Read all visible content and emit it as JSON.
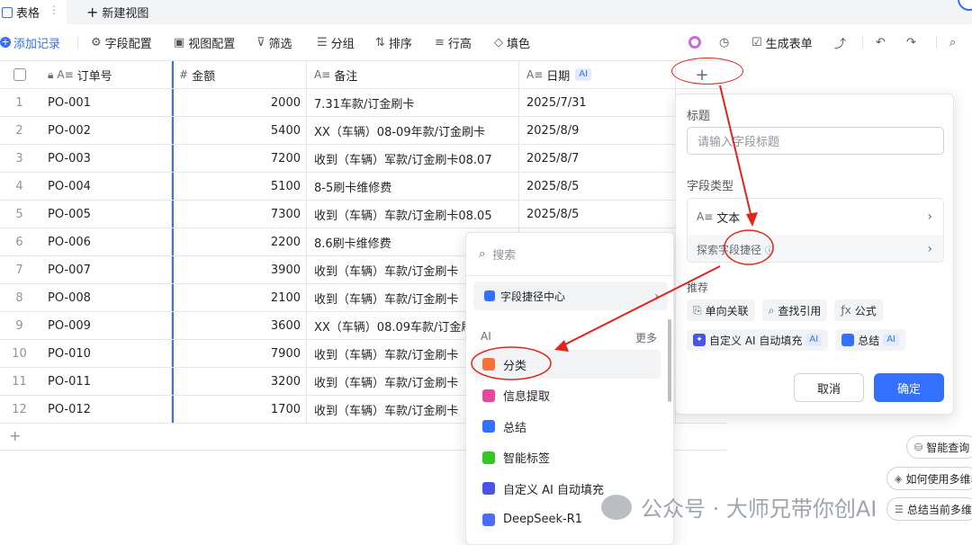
{
  "tabs": {
    "active": "表格",
    "new_view": "新建视图"
  },
  "toolbar": {
    "add_record": "添加记录",
    "field_config": "字段配置",
    "view_config": "视图配置",
    "filter": "筛选",
    "group": "分组",
    "sort": "排序",
    "row_height": "行高",
    "fill_color": "填色",
    "generate_form": "生成表单"
  },
  "columns": [
    {
      "icon": "A≡",
      "label": "订单号"
    },
    {
      "icon": "#",
      "label": "金额"
    },
    {
      "icon": "A≡",
      "label": "备注"
    },
    {
      "icon": "A≡",
      "label": "日期",
      "badge": "AI"
    }
  ],
  "rows": [
    {
      "no": "1",
      "order": "PO-001",
      "amount": "2000",
      "note": "7.31车款/订金刷卡",
      "date": "2025/7/31"
    },
    {
      "no": "2",
      "order": "PO-002",
      "amount": "5400",
      "note": "XX（车辆）08-09年款/订金刷卡",
      "date": "2025/8/9"
    },
    {
      "no": "3",
      "order": "PO-003",
      "amount": "7200",
      "note": "收到（车辆）军款/订金刷卡08.07",
      "date": "2025/8/7"
    },
    {
      "no": "4",
      "order": "PO-004",
      "amount": "5100",
      "note": "8-5刷卡维修费",
      "date": "2025/8/5"
    },
    {
      "no": "5",
      "order": "PO-005",
      "amount": "7300",
      "note": "收到（车辆）车款/订金刷卡08.05",
      "date": "2025/8/5"
    },
    {
      "no": "6",
      "order": "PO-006",
      "amount": "2200",
      "note": "8.6刷卡维修费",
      "date": ""
    },
    {
      "no": "7",
      "order": "PO-007",
      "amount": "3900",
      "note": "收到（车辆）车款/订金刷卡",
      "date": ""
    },
    {
      "no": "8",
      "order": "PO-008",
      "amount": "2100",
      "note": "收到（车辆）车款/订金刷卡",
      "date": ""
    },
    {
      "no": "9",
      "order": "PO-009",
      "amount": "3600",
      "note": "XX（车辆）08.09车款/订金刷",
      "date": ""
    },
    {
      "no": "10",
      "order": "PO-010",
      "amount": "7900",
      "note": "收到（车辆）车款/订金刷卡",
      "date": ""
    },
    {
      "no": "11",
      "order": "PO-011",
      "amount": "3200",
      "note": "收到（车辆）车款/订金刷卡",
      "date": ""
    },
    {
      "no": "12",
      "order": "PO-012",
      "amount": "1700",
      "note": "收到（车辆）车款/订金刷卡",
      "date": ""
    }
  ],
  "field_panel": {
    "title_label": "标题",
    "title_placeholder": "请输入字段标题",
    "type_label": "字段类型",
    "type_value_icon": "A≡",
    "type_value": "文本",
    "explore_shortcut": "探索字段捷径",
    "recommend_label": "推荐",
    "recommend_row1": [
      "单向关联",
      "查找引用",
      "公式"
    ],
    "recommend_row2": [
      "自定义 AI 自动填充",
      "总结"
    ],
    "ai_badge": "AI",
    "cancel": "取消",
    "confirm": "确定"
  },
  "dropdown": {
    "search_placeholder": "搜索",
    "shortcut_center": "字段捷径中心",
    "section": "AI",
    "more": "更多",
    "items": [
      {
        "label": "分类",
        "color": "#f77234"
      },
      {
        "label": "信息提取",
        "color": "#e8479c"
      },
      {
        "label": "总结",
        "color": "#3370ff"
      },
      {
        "label": "智能标签",
        "color": "#34c724"
      },
      {
        "label": "自定义 AI 自动填充",
        "color": "#4954e6"
      },
      {
        "label": "DeepSeek-R1",
        "color": "#4d6bfe"
      }
    ]
  },
  "side_pills": [
    "智能查询",
    "如何使用多维表",
    "总结当前多维表"
  ],
  "watermark": "公众号 · 大师兄带你创AI",
  "colors": {
    "accent": "#3370ff",
    "annotation": "#e0251b"
  }
}
